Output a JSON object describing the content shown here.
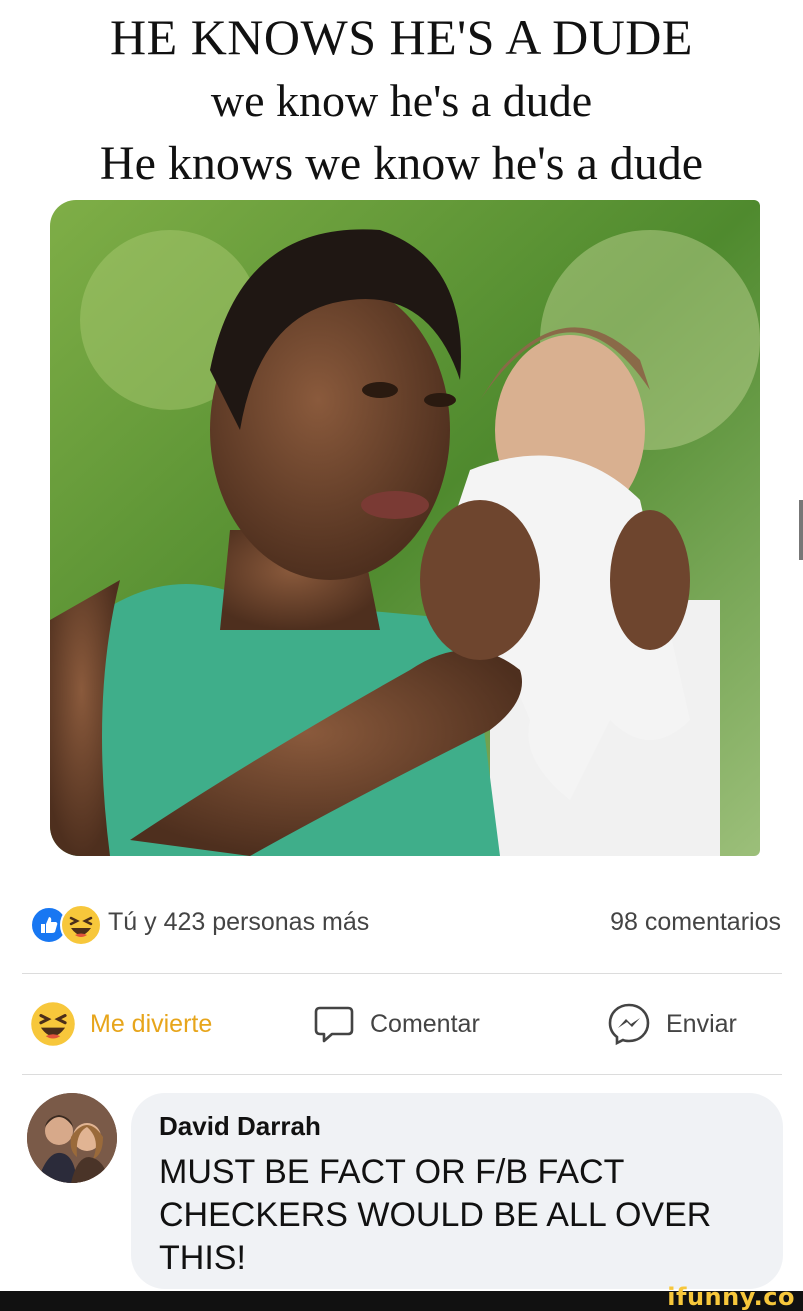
{
  "meme": {
    "line1": "HE KNOWS HE'S A DUDE",
    "line2": "we know he's a dude",
    "line3": "He knows we know he's a dude"
  },
  "reactions": {
    "summary": "Tú y 423 personas más",
    "comments": "98 comentarios",
    "icons": [
      "like-icon",
      "haha-icon"
    ]
  },
  "actions": {
    "haha_label": "Me divierte",
    "comment_label": "Comentar",
    "send_label": "Enviar"
  },
  "comment": {
    "author": "David Darrah",
    "text": "MUST BE FACT OR F/B FACT CHECKERS WOULD BE ALL OVER THIS!"
  },
  "watermark": "ifunny.co",
  "colors": {
    "like_blue": "#1877f2",
    "haha_yellow": "#f7c73b",
    "reacted_label": "#e7a51b",
    "bubble_bg": "#f0f2f5"
  }
}
